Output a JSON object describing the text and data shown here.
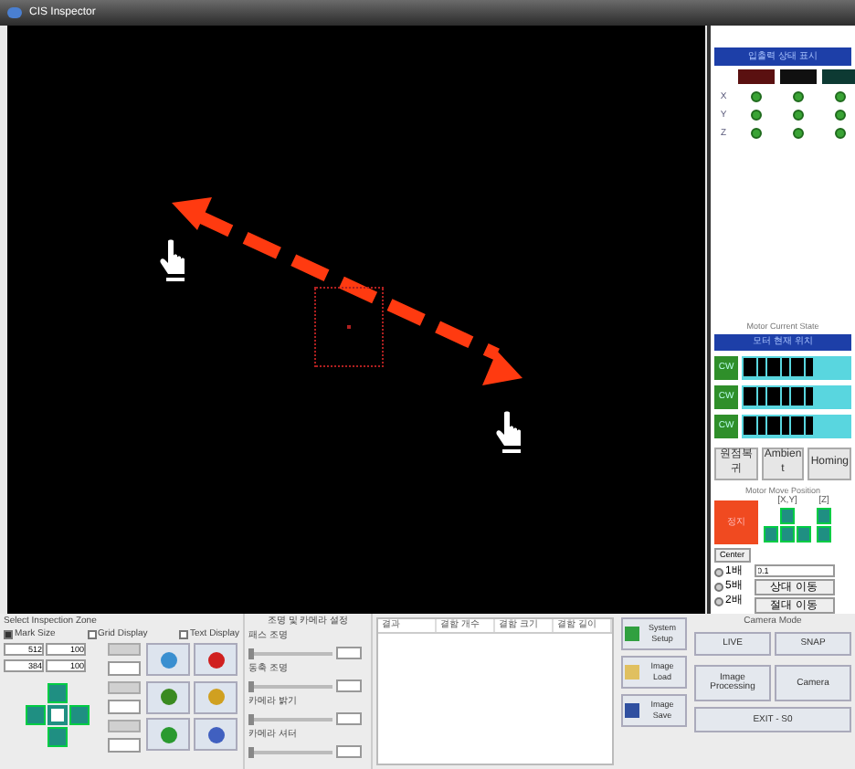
{
  "window": {
    "title": "CIS Inspector"
  },
  "io_panel": {
    "header": "입출력 상태 표시",
    "columns": [
      {
        "color": "#5a1010"
      },
      {
        "color": "#101010"
      },
      {
        "color": "#0d3a33"
      }
    ],
    "rows": [
      {
        "label": "X",
        "lamps": [
          true,
          true,
          true
        ]
      },
      {
        "label": "Y",
        "lamps": [
          true,
          true,
          true
        ]
      },
      {
        "label": "Z",
        "lamps": [
          true,
          true,
          true
        ]
      }
    ]
  },
  "motor_current": {
    "title": "Motor Current State",
    "header": "모터 현재 위치",
    "axes": [
      {
        "label": "CW"
      },
      {
        "label": "CW"
      },
      {
        "label": "CW"
      }
    ],
    "buttons": [
      "원점복귀",
      "Ambient",
      "Homing"
    ]
  },
  "motor_move": {
    "title": "Motor Move Position",
    "stop": "정지",
    "xy_label": "[X,Y]",
    "z_label": "[Z]",
    "center": "Center",
    "speeds": [
      {
        "label": "1배",
        "selected": false
      },
      {
        "label": "5배",
        "selected": false
      },
      {
        "label": "2배",
        "selected": false
      }
    ],
    "step": "0.1",
    "cmd1": "상대 이동",
    "cmd2": "절대 이동"
  },
  "inspection_zone": {
    "title": "Select Inspection Zone",
    "checks": [
      {
        "label": "Mark Size",
        "checked": true
      },
      {
        "label": "Grid Display",
        "checked": false
      },
      {
        "label": "Text Display",
        "checked": false
      }
    ],
    "ranges": [
      {
        "from": "512",
        "to": "100"
      },
      {
        "from": "384",
        "to": "100"
      }
    ]
  },
  "lighting": {
    "title": "조명 및 카메라 설정",
    "sliders": [
      {
        "label": "패스 조명",
        "level": 0.0
      },
      {
        "label": "동축 조명",
        "level": 0.0
      },
      {
        "label": "카메라 밝기",
        "level": 0.0
      },
      {
        "label": "카메라 셔터",
        "level": 0.0
      }
    ]
  },
  "results": {
    "columns": [
      "결과",
      "결함 개수",
      "결함 크기",
      "결함 길이"
    ]
  },
  "file_buttons": [
    {
      "label": "System Setup",
      "kind": "setup"
    },
    {
      "label": "Image Load",
      "kind": "load"
    },
    {
      "label": "Image Save",
      "kind": "save"
    }
  ],
  "camera": {
    "title": "Camera Mode",
    "live": "LIVE",
    "snap": "SNAP",
    "processing": "Image Processing",
    "calib": "Camera",
    "exit": "EXIT - S0"
  }
}
